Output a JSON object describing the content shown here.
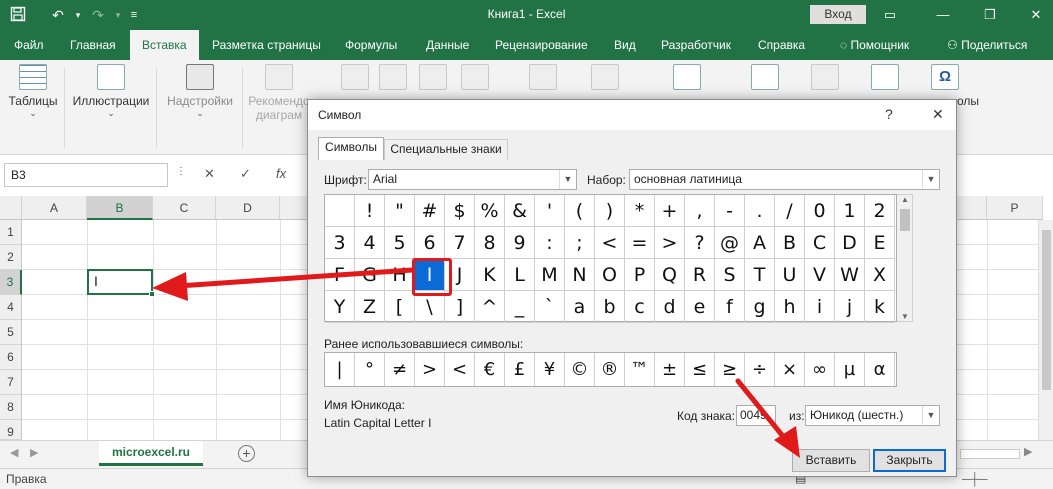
{
  "app": {
    "window_title": "Книга1  -  Excel",
    "signin_label": "Вход"
  },
  "ribbon_tabs": [
    "Файл",
    "Главная",
    "Вставка",
    "Разметка страницы",
    "Формулы",
    "Данные",
    "Рецензирование",
    "Вид",
    "Разработчик",
    "Справка",
    "Помощник",
    "Поделиться"
  ],
  "active_tab": "Вставка",
  "ribbon_groups": [
    {
      "label": "Таблицы",
      "enabled": true
    },
    {
      "label": "Иллюстрации",
      "enabled": true
    },
    {
      "label": "Надстройки",
      "enabled": false
    },
    {
      "label": "Рекомендо",
      "sub": "диаграм",
      "enabled": false
    },
    {
      "label": "олы",
      "enabled": true
    }
  ],
  "formula_bar": {
    "name_box": "B3",
    "formula_value": ""
  },
  "grid": {
    "columns": [
      "A",
      "B",
      "C",
      "D",
      "P"
    ],
    "rows": [
      "1",
      "2",
      "3",
      "4",
      "5",
      "6",
      "7",
      "8",
      "9"
    ],
    "selected_column": "B",
    "selected_row": "3",
    "active_cell_value": "I"
  },
  "sheet_tabs": [
    {
      "name": "microexcel.ru",
      "active": true
    }
  ],
  "status_bar": {
    "mode": "Правка"
  },
  "dialog": {
    "title": "Символ",
    "help_icon": "?",
    "close_icon": "✕",
    "tabs": [
      "Символы",
      "Специальные знаки"
    ],
    "font_label": "Шрифт:",
    "font_value": "Arial",
    "subset_label": "Набор:",
    "subset_value": "основная латиница",
    "symbols": [
      [
        "",
        "!",
        "\"",
        "#",
        "$",
        "%",
        "&",
        "'",
        "(",
        ")",
        "*",
        "+",
        ",",
        "-",
        ".",
        "/",
        "0",
        "1",
        "2"
      ],
      [
        "3",
        "4",
        "5",
        "6",
        "7",
        "8",
        "9",
        ":",
        ";",
        "<",
        "=",
        ">",
        "?",
        "@",
        "A",
        "B",
        "C",
        "D",
        "E"
      ],
      [
        "F",
        "G",
        "H",
        "I",
        "J",
        "K",
        "L",
        "M",
        "N",
        "O",
        "P",
        "Q",
        "R",
        "S",
        "T",
        "U",
        "V",
        "W",
        "X"
      ],
      [
        "Y",
        "Z",
        "[",
        "\\",
        "]",
        "^",
        "_",
        "`",
        "a",
        "b",
        "c",
        "d",
        "e",
        "f",
        "g",
        "h",
        "i",
        "j",
        "k"
      ]
    ],
    "selected_symbol": "I",
    "recent_label": "Ранее использовавшиеся символы:",
    "recent_symbols": [
      "|",
      "°",
      "≠",
      ">",
      "<",
      "€",
      "£",
      "¥",
      "©",
      "®",
      "™",
      "±",
      "≤",
      "≥",
      "÷",
      "×",
      "∞",
      "µ",
      "α"
    ],
    "unicode_name_label": "Имя Юникода:",
    "unicode_name_value": "Latin Capital Letter I",
    "char_code_label": "Код знака:",
    "char_code_value": "0049",
    "from_label": "из:",
    "from_value": "Юникод (шестн.)",
    "insert_button": "Вставить",
    "close_button": "Закрыть"
  },
  "colors": {
    "excel_green": "#217346",
    "annotation_red": "#e0191b",
    "selection_blue": "#0a6ad6"
  }
}
